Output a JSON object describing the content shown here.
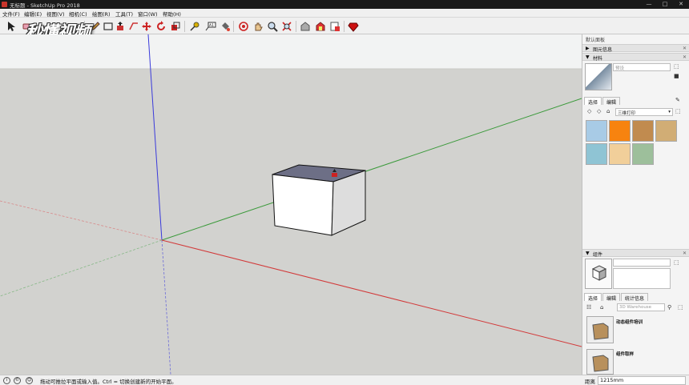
{
  "window": {
    "title": "无标题 - SketchUp Pro 2018",
    "controls": [
      "minimize-icon",
      "maximize-icon",
      "close-icon"
    ]
  },
  "menu": [
    "文件(F)",
    "编辑(E)",
    "视图(V)",
    "相机(C)",
    "绘图(R)",
    "工具(T)",
    "窗口(W)",
    "帮助(H)"
  ],
  "toolbar": {
    "tools": [
      "select-icon",
      "eraser-icon",
      "paint-bucket-icon",
      "pencil-icon",
      "rectangle-icon",
      "arc-icon",
      "push-pull-icon",
      "offset-icon",
      "move-icon",
      "rotate-icon",
      "scale-icon",
      "tape-measure-icon",
      "text-icon",
      "protractor-icon",
      "orbit-icon",
      "pan-icon",
      "zoom-icon",
      "zoom-extents-icon",
      "warehouse-icon",
      "extension-warehouse-icon",
      "layout-icon",
      "ruby-icon"
    ]
  },
  "watermark": {
    "text": "秒懂视频"
  },
  "tray": {
    "title": "默认面板",
    "entity_info": {
      "label": "图元信息"
    },
    "materials": {
      "label": "材料",
      "name_placeholder": "预设",
      "tabs": [
        "选择",
        "编辑"
      ],
      "library": "三维打印",
      "swatches": [
        "#a8cbe6",
        "#f7830f",
        "#c18b4f",
        "#d1ad75",
        "#8fc4d4",
        "#f1cf9a",
        "#9dbf9b"
      ]
    },
    "components": {
      "label": "组件",
      "tabs": [
        "选择",
        "编辑",
        "统计信息"
      ],
      "search_placeholder": "3D Warehouse",
      "items": [
        "动态组件培训",
        "组件取样"
      ]
    }
  },
  "statusbar": {
    "hint": "拖动可推拉平面或输入值。Ctrl = 切换创建新的开始平面。",
    "distance_label": "距离",
    "distance_value": "1215mm"
  }
}
